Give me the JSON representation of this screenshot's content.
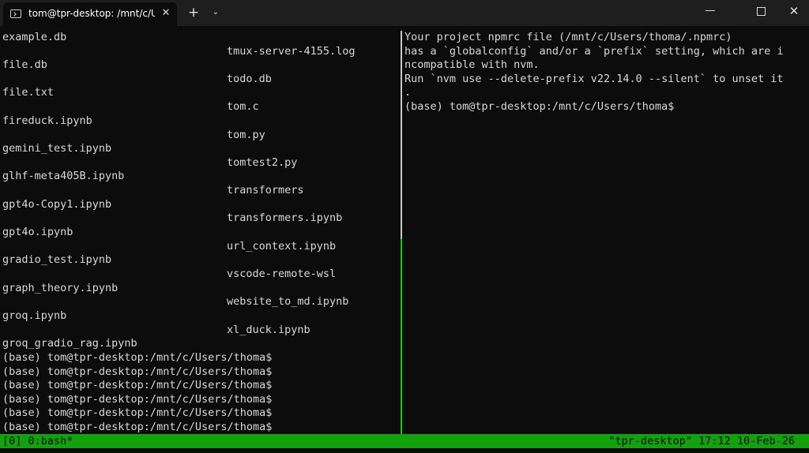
{
  "window": {
    "tab_title": "tom@tpr-desktop: /mnt/c/Us",
    "tab_close": "✕",
    "new_tab": "+",
    "tab_dropdown": "⌄",
    "minimize": "—",
    "close": "✕"
  },
  "left_pane": {
    "col1": [
      "example.db",
      "file.db",
      "file.txt",
      "fireduck.ipynb",
      "gemini_test.ipynb",
      "glhf-meta405B.ipynb",
      "gpt4o-Copy1.ipynb",
      "gpt4o.ipynb",
      "gradio_test.ipynb",
      "graph_theory.ipynb",
      "groq.ipynb",
      "groq_gradio_rag.ipynb"
    ],
    "col2": [
      "tmux-server-4155.log",
      "todo.db",
      "tom.c",
      "tom.py",
      "tomtest2.py",
      "transformers",
      "transformers.ipynb",
      "url_context.ipynb",
      "vscode-remote-wsl",
      "website_to_md.ipynb",
      "xl_duck.ipynb"
    ],
    "prompts": [
      "(base) tom@tpr-desktop:/mnt/c/Users/thoma$",
      "(base) tom@tpr-desktop:/mnt/c/Users/thoma$",
      "(base) tom@tpr-desktop:/mnt/c/Users/thoma$",
      "(base) tom@tpr-desktop:/mnt/c/Users/thoma$",
      "(base) tom@tpr-desktop:/mnt/c/Users/thoma$",
      "(base) tom@tpr-desktop:/mnt/c/Users/thoma$"
    ]
  },
  "right_pane": {
    "lines": [
      "Your project npmrc file (/mnt/c/Users/thoma/.npmrc)",
      "has a `globalconfig` and/or a `prefix` setting, which are i",
      "ncompatible with nvm.",
      "Run `nvm use --delete-prefix v22.14.0 --silent` to unset it",
      ".",
      "(base) tom@tpr-desktop:/mnt/c/Users/thoma$"
    ]
  },
  "status_bar": {
    "left": "[0] 0:bash*",
    "right": "\"tpr-desktop\" 17:12 10-Feb-26"
  },
  "colors": {
    "background": "#0c0c0c",
    "status_bar": "#13a10e",
    "active_pane_border": "#16c60c"
  }
}
